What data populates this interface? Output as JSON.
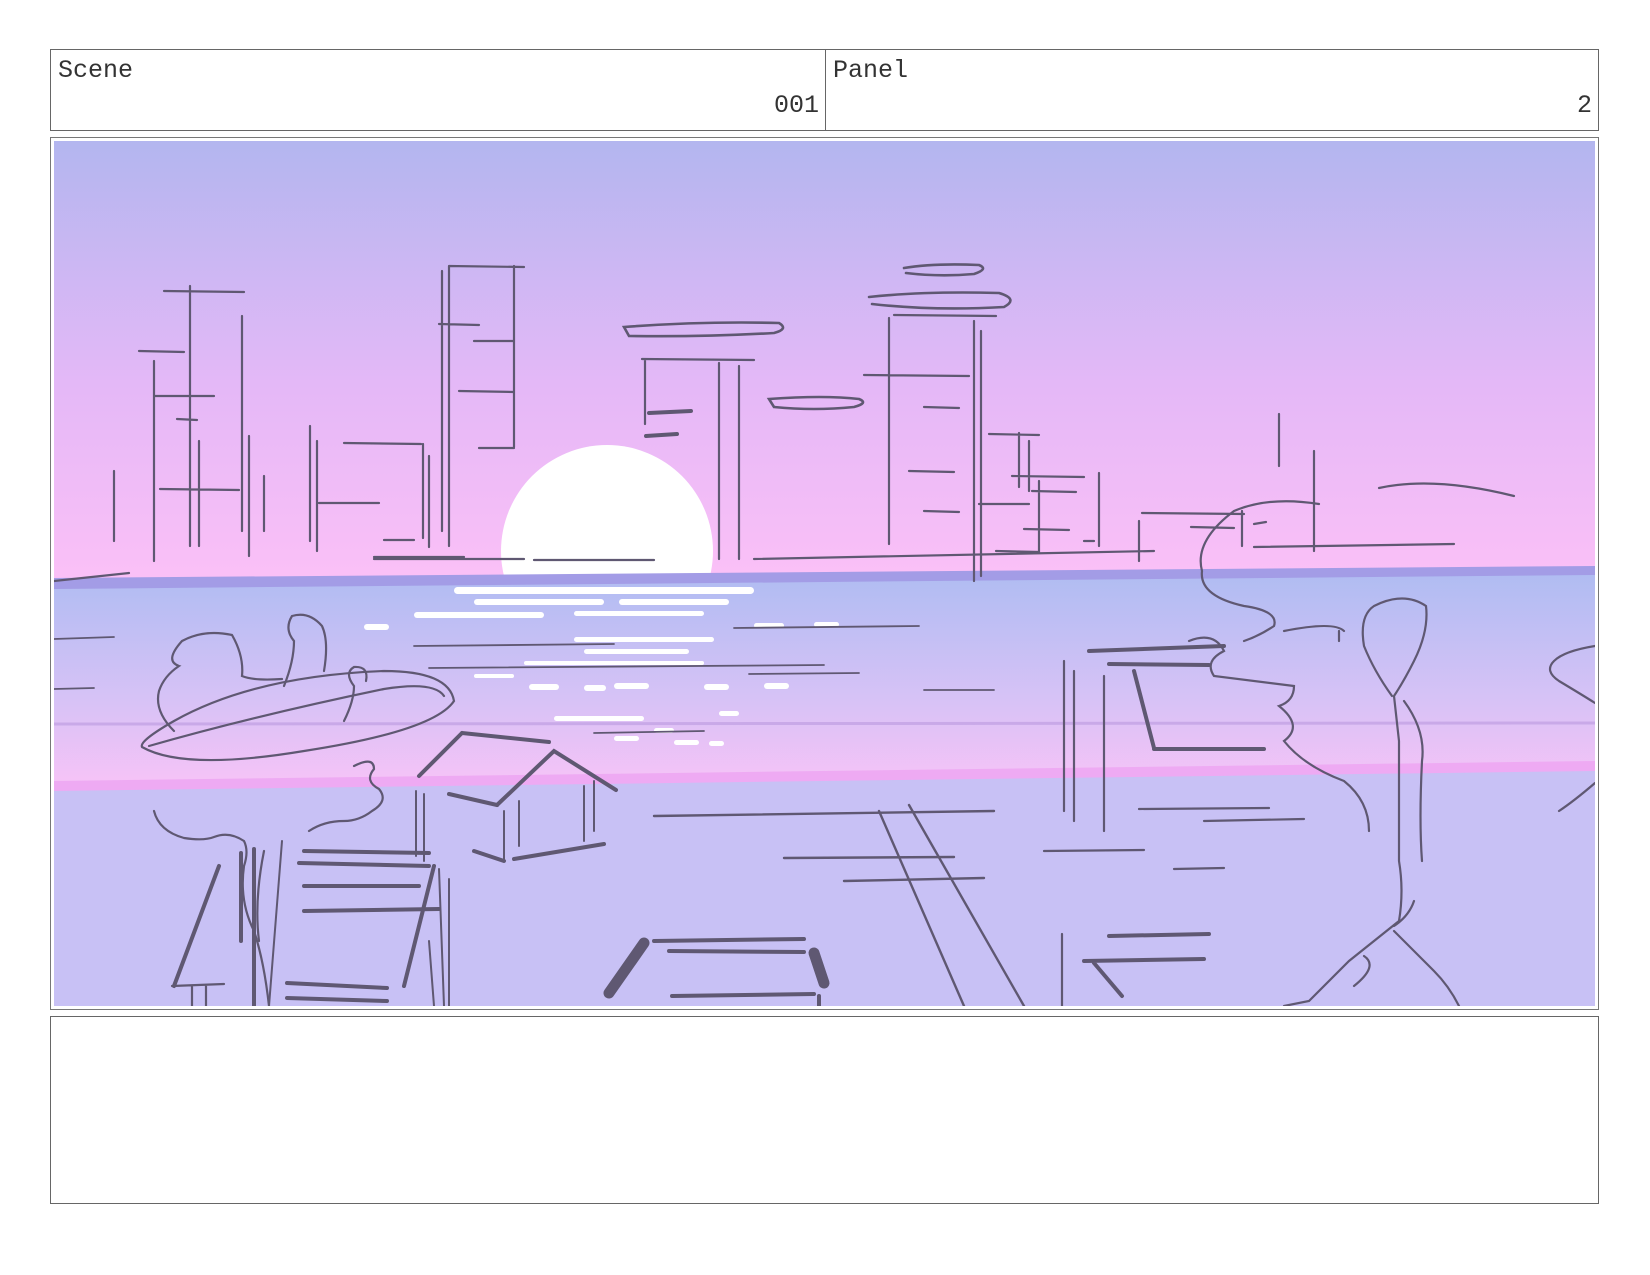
{
  "header": {
    "scene_label": "Scene",
    "scene_value": "001",
    "panel_label": "Panel",
    "panel_value": "2"
  },
  "artwork": {
    "subject": "sunset-city-waterfront-sketch",
    "colors": {
      "sky_top": "#b3b6ef",
      "sky_bottom": "#fbc0f7",
      "water_top": "#aebcf2",
      "water_bottom": "#f8c3f7",
      "ground": "#c8c1f5",
      "sun": "#ffffff",
      "line": "#5f5872"
    }
  },
  "notes": {
    "text": ""
  }
}
